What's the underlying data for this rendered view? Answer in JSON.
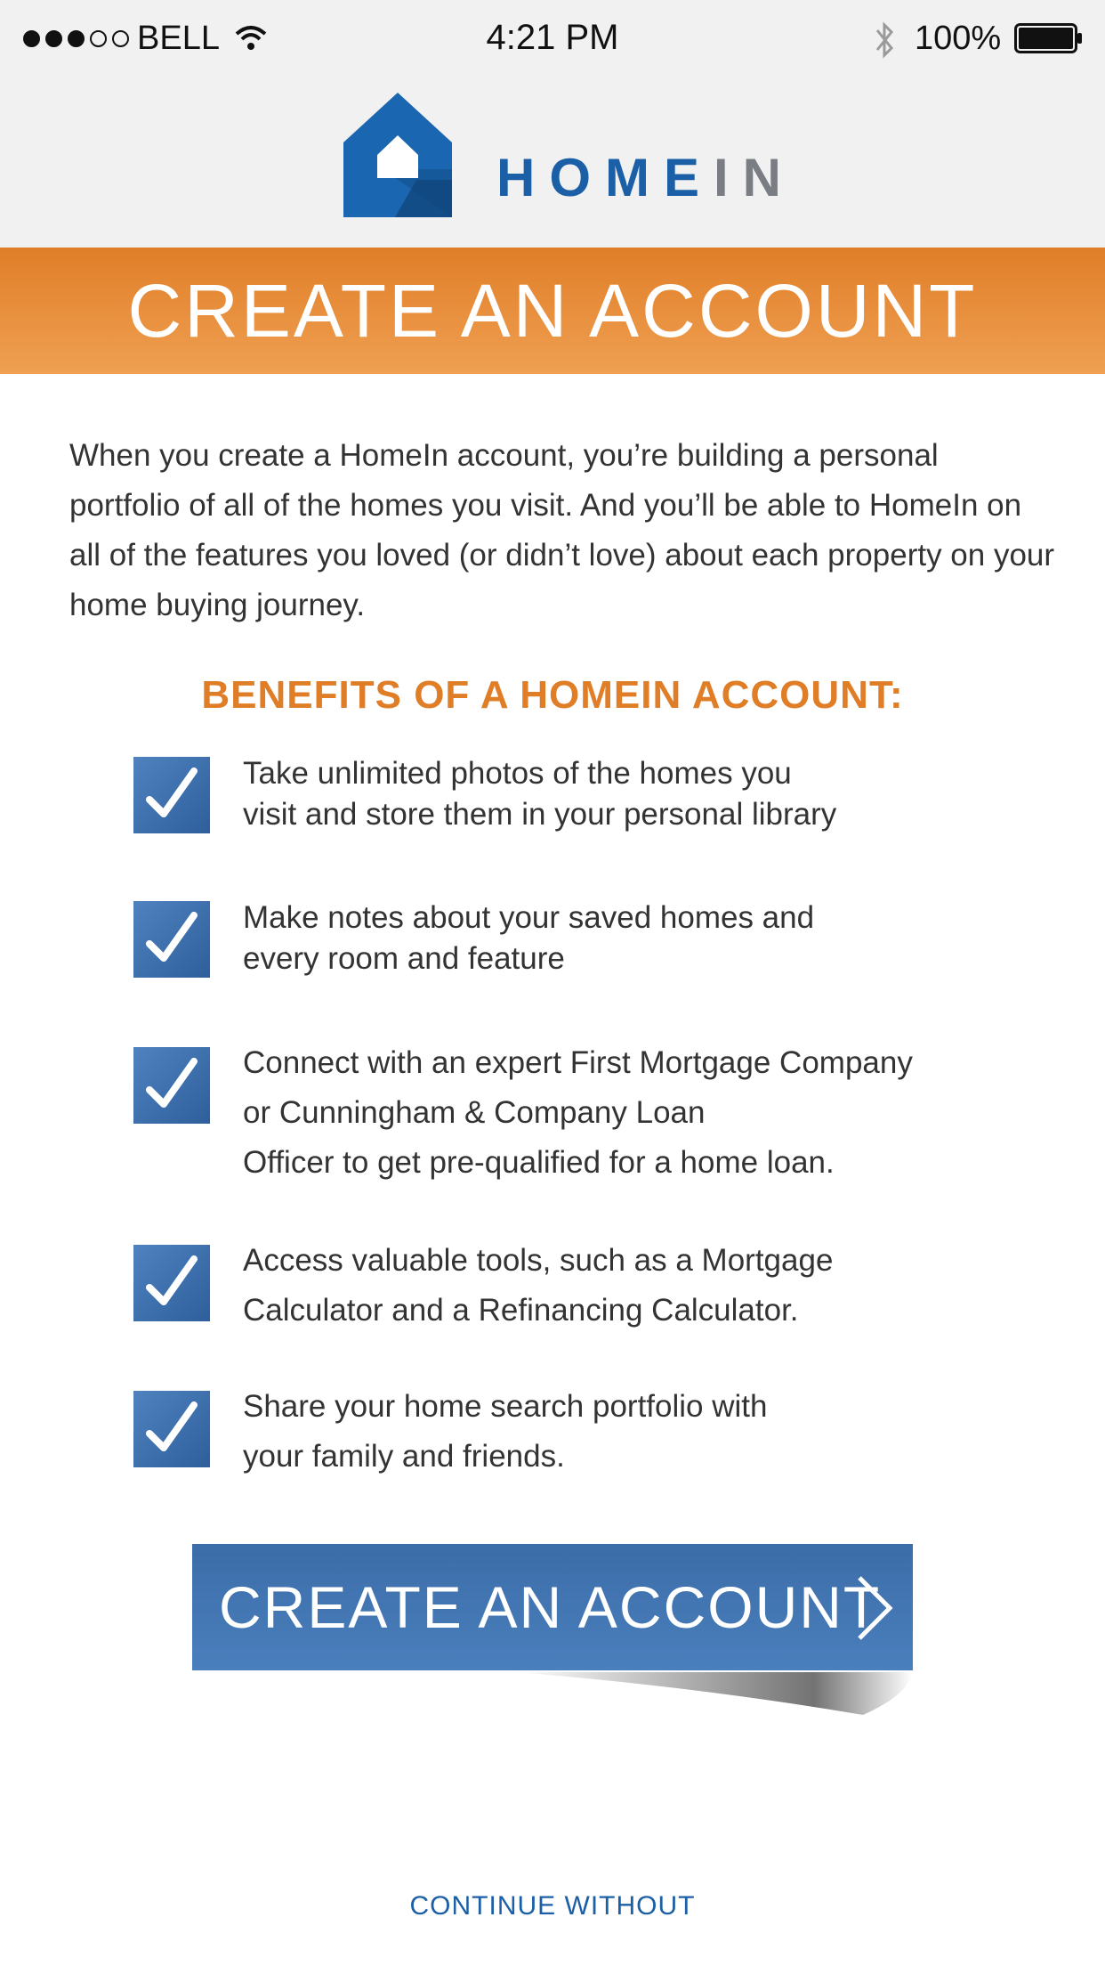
{
  "status_bar": {
    "carrier": "BELL",
    "time": "4:21 PM",
    "battery": "100%"
  },
  "logo": {
    "brand_main": "HOME",
    "brand_suffix": "IN"
  },
  "banner": {
    "title": "CREATE AN ACCOUNT"
  },
  "intro": {
    "text": "When you create a HomeIn account, you’re building a personal portfolio of all of the homes you visit. And you’ll be able to HomeIn on all of the features you loved (or didn’t love) about each property on your home buying  journey."
  },
  "benefits": {
    "title": "BENEFITS OF A HOMEIN ACCOUNT:",
    "items": [
      {
        "line1": "Take unlimited photos of the homes you",
        "line2": "visit and store them in your personal library",
        "line3": ""
      },
      {
        "line1": "Make notes about your saved homes and",
        "line2": "every room and feature",
        "line3": ""
      },
      {
        "line1": "Connect with an expert First Mortgage Company",
        "line2": "or Cunningham & Company Loan",
        "line3": "Officer to get pre-qualified for a home loan."
      },
      {
        "line1": "Access valuable tools, such as a Mortgage",
        "line2": "Calculator and a Refinancing Calculator.",
        "line3": ""
      },
      {
        "line1": "Share your home search portfolio with",
        "line2": "your family and friends.",
        "line3": ""
      }
    ]
  },
  "cta": {
    "label": "CREATE AN ACCOUNT"
  },
  "continue": {
    "label": "CONTINUE WITHOUT"
  },
  "colors": {
    "brand_blue": "#1b5fa6",
    "accent_orange": "#e07e28",
    "button_blue": "#4a7fbd"
  }
}
